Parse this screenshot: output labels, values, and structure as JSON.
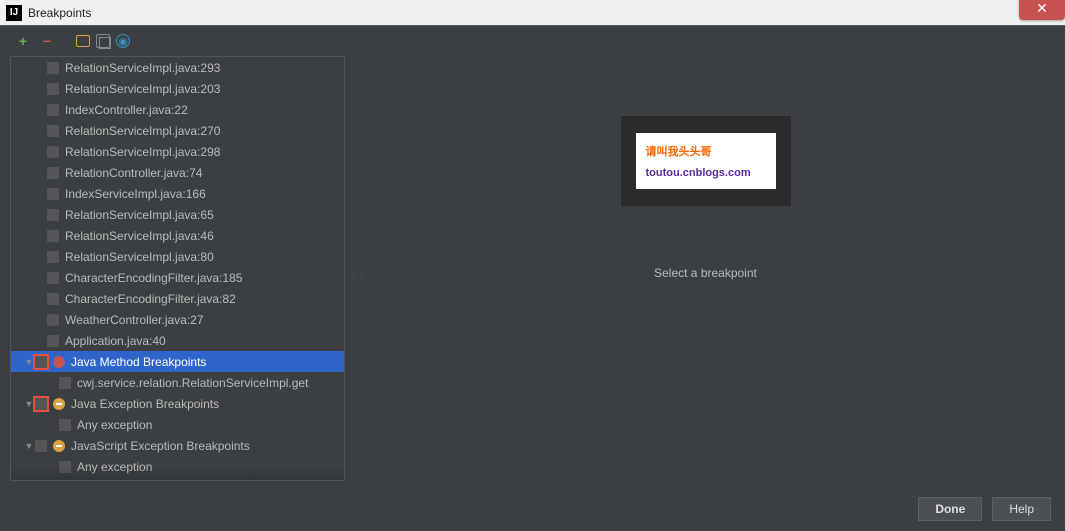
{
  "window": {
    "title": "Breakpoints"
  },
  "tree": {
    "lines": [
      {
        "indent": "leaf",
        "label": "RelationServiceImpl.java:293"
      },
      {
        "indent": "leaf",
        "label": "RelationServiceImpl.java:203"
      },
      {
        "indent": "leaf",
        "label": "IndexController.java:22"
      },
      {
        "indent": "leaf",
        "label": "RelationServiceImpl.java:270"
      },
      {
        "indent": "leaf",
        "label": "RelationServiceImpl.java:298"
      },
      {
        "indent": "leaf",
        "label": "RelationController.java:74"
      },
      {
        "indent": "leaf",
        "label": "IndexServiceImpl.java:166"
      },
      {
        "indent": "leaf",
        "label": "RelationServiceImpl.java:65"
      },
      {
        "indent": "leaf",
        "label": "RelationServiceImpl.java:46"
      },
      {
        "indent": "leaf",
        "label": "RelationServiceImpl.java:80"
      },
      {
        "indent": "leaf",
        "label": "CharacterEncodingFilter.java:185"
      },
      {
        "indent": "leaf",
        "label": "CharacterEncodingFilter.java:82"
      },
      {
        "indent": "leaf",
        "label": "WeatherController.java:27"
      },
      {
        "indent": "leaf",
        "label": "Application.java:40"
      }
    ],
    "group_method": "Java Method Breakpoints",
    "method_item": "cwj.service.relation.RelationServiceImpl.get",
    "group_exception": "Java Exception Breakpoints",
    "exception_item": "Any exception",
    "group_js_exception": "JavaScript Exception Breakpoints",
    "js_exception_item": "Any exception"
  },
  "detail": {
    "message": "Select a breakpoint",
    "preview": {
      "line1": "请叫我头头哥",
      "line2": "toutou.cnblogs.com"
    }
  },
  "buttons": {
    "done": "Done",
    "help": "Help"
  }
}
